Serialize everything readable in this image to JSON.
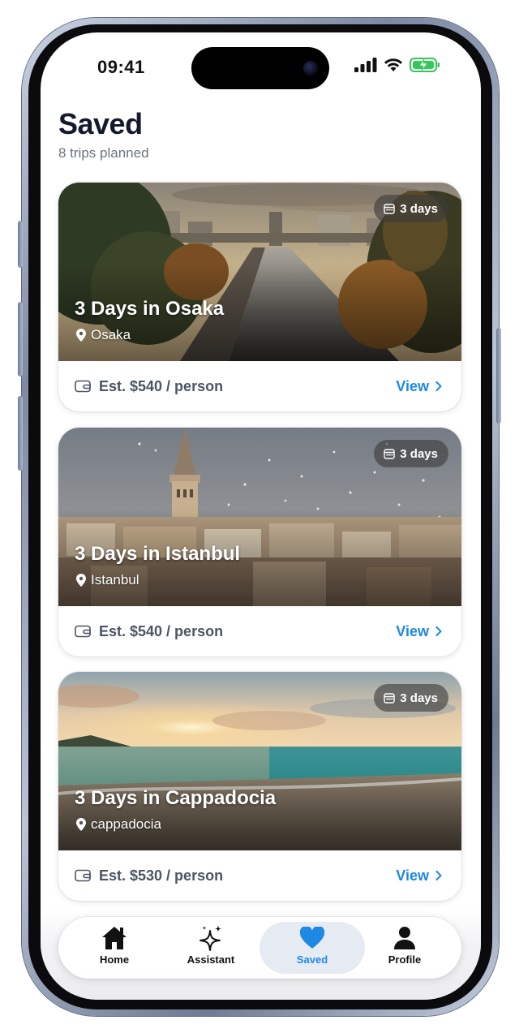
{
  "status_bar": {
    "time": "09:41"
  },
  "header": {
    "title": "Saved",
    "subtitle": "8 trips planned"
  },
  "trips": [
    {
      "title": "3 Days in Osaka",
      "location": "Osaka",
      "duration": "3 days",
      "price": "Est. $540 / person",
      "action": "View",
      "image": "osaka-street-photo"
    },
    {
      "title": "3 Days in Istanbul",
      "location": "Istanbul",
      "duration": "3 days",
      "price": "Est. $540 / person",
      "action": "View",
      "image": "istanbul-galata-tower-photo"
    },
    {
      "title": "3 Days in Cappadocia",
      "location": "cappadocia",
      "duration": "3 days",
      "price": "Est. $530 / person",
      "action": "View",
      "image": "beach-sunset-photo"
    }
  ],
  "tabbar": {
    "items": [
      {
        "label": "Home",
        "icon": "home-icon"
      },
      {
        "label": "Assistant",
        "icon": "sparkles-icon"
      },
      {
        "label": "Saved",
        "icon": "heart-icon",
        "active": true
      },
      {
        "label": "Profile",
        "icon": "person-icon"
      }
    ]
  },
  "colors": {
    "accent": "#1e88e5",
    "title": "#141a2e",
    "muted": "#6b7280",
    "battery": "#34c759"
  }
}
